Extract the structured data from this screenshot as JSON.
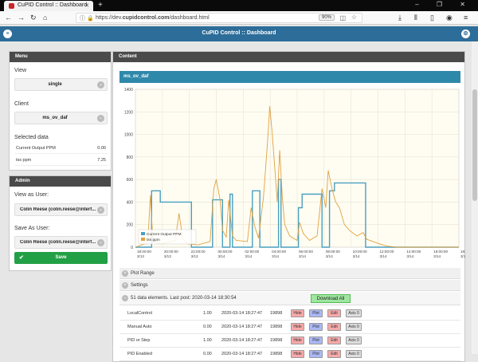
{
  "browser": {
    "tab_title": "CuPID Control :: Dashboard",
    "url_prefix": "https://dev.",
    "url_domain": "cupidcontrol.com",
    "url_path": "/dashboard.html",
    "zoom": "90%"
  },
  "app": {
    "title": "CuPID Control :: Dashboard"
  },
  "menu": {
    "header": "Menu",
    "view_label": "View",
    "view_value": "single",
    "client_label": "Client",
    "client_value": "ms_ov_daf",
    "selected_label": "Selected data",
    "selected": [
      {
        "name": "Current Output PPM",
        "value": "0.00"
      },
      {
        "name": "tss ppm",
        "value": "7.25"
      }
    ]
  },
  "admin": {
    "header": "Admin",
    "view_as_label": "View as User:",
    "view_as_value": "Colin Reese (colin.reese@interf...",
    "save_as_label": "Save As User:",
    "save_as_value": "Colin Reese (colin.reese@interf...",
    "save_label": "Save"
  },
  "content": {
    "header": "Content",
    "chart_title": "ms_ov_daf",
    "plot_range": "Plot Range",
    "settings": "Settings",
    "elements_summary": "51 data elements. Last post: 2020-03-14 18:30:54",
    "download_all": "Download All"
  },
  "buttons": {
    "hide": "Hide",
    "plot": "Plot",
    "edit": "Edit",
    "axis": "Axis 0"
  },
  "rows": [
    {
      "name": "LocalControl",
      "value": "1.00",
      "time": "2020-03-14 18:27:47",
      "count": "19898"
    },
    {
      "name": "Manual Auto",
      "value": "0.00",
      "time": "2020-03-14 18:27:47",
      "count": "19898"
    },
    {
      "name": "PID or Step",
      "value": "1.00",
      "time": "2020-03-14 18:27:47",
      "count": "19898"
    },
    {
      "name": "PID Enabled",
      "value": "0.00",
      "time": "2020-03-14 18:27:47",
      "count": "19898"
    }
  ],
  "chart_data": {
    "type": "line",
    "title": "",
    "ylim": [
      0,
      1400
    ],
    "yticks": [
      "0",
      "200",
      "400",
      "600",
      "800",
      "1000",
      "1200",
      "1400"
    ],
    "xticks": [
      {
        "t": "18:00:00",
        "d": "3/13"
      },
      {
        "t": "20:00:00",
        "d": "3/13"
      },
      {
        "t": "22:00:00",
        "d": "3/13"
      },
      {
        "t": "00:00:00",
        "d": "3/14"
      },
      {
        "t": "02:00:00",
        "d": "3/14"
      },
      {
        "t": "04:00:00",
        "d": "3/14"
      },
      {
        "t": "06:00:00",
        "d": "3/14"
      },
      {
        "t": "08:00:00",
        "d": "3/14"
      },
      {
        "t": "10:00:00",
        "d": "3/14"
      },
      {
        "t": "12:00:00",
        "d": "3/14"
      },
      {
        "t": "14:00:00",
        "d": "3/14"
      },
      {
        "t": "16:00:00",
        "d": "3/14"
      },
      {
        "t": "18:00:00",
        "d": "3/14"
      }
    ],
    "xlim_hours": [
      0,
      26
    ],
    "legend_position": "bottom-left",
    "series": [
      {
        "name": "Current Output PPM",
        "color": "#4a9fc0",
        "points": [
          [
            0,
            0
          ],
          [
            1.3,
            0
          ],
          [
            1.3,
            500
          ],
          [
            2.0,
            500
          ],
          [
            2.0,
            400
          ],
          [
            4.5,
            400
          ],
          [
            4.5,
            0
          ],
          [
            6.2,
            0
          ],
          [
            6.2,
            420
          ],
          [
            7.0,
            420
          ],
          [
            7.0,
            0
          ],
          [
            7.6,
            0
          ],
          [
            7.6,
            470
          ],
          [
            7.8,
            470
          ],
          [
            7.8,
            0
          ],
          [
            9.4,
            0
          ],
          [
            9.4,
            500
          ],
          [
            10.0,
            500
          ],
          [
            10.0,
            0
          ],
          [
            11.5,
            0
          ],
          [
            11.5,
            600
          ],
          [
            11.7,
            600
          ],
          [
            11.7,
            0
          ],
          [
            13.1,
            0
          ],
          [
            13.1,
            350
          ],
          [
            13.4,
            350
          ],
          [
            13.4,
            470
          ],
          [
            15.0,
            470
          ],
          [
            15.0,
            0
          ],
          [
            15.6,
            0
          ],
          [
            15.6,
            500
          ],
          [
            16.0,
            500
          ],
          [
            16.0,
            570
          ],
          [
            18.5,
            570
          ],
          [
            18.5,
            0
          ],
          [
            26,
            0
          ]
        ]
      },
      {
        "name": "tss ppm",
        "color": "#e0a040",
        "points": [
          [
            0,
            0
          ],
          [
            1.0,
            40
          ],
          [
            1.2,
            460
          ],
          [
            1.4,
            60
          ],
          [
            2.0,
            30
          ],
          [
            3.2,
            60
          ],
          [
            3.5,
            300
          ],
          [
            3.8,
            80
          ],
          [
            4.2,
            30
          ],
          [
            5.0,
            20
          ],
          [
            6.0,
            50
          ],
          [
            6.3,
            520
          ],
          [
            6.5,
            600
          ],
          [
            6.8,
            420
          ],
          [
            7.0,
            150
          ],
          [
            7.3,
            90
          ],
          [
            7.5,
            420
          ],
          [
            7.8,
            100
          ],
          [
            8.1,
            60
          ],
          [
            9.0,
            50
          ],
          [
            9.3,
            350
          ],
          [
            9.6,
            180
          ],
          [
            9.9,
            80
          ],
          [
            10.3,
            450
          ],
          [
            10.6,
            900
          ],
          [
            10.8,
            1250
          ],
          [
            11.0,
            1000
          ],
          [
            11.2,
            700
          ],
          [
            11.4,
            400
          ],
          [
            11.6,
            860
          ],
          [
            11.8,
            450
          ],
          [
            12.0,
            200
          ],
          [
            12.4,
            100
          ],
          [
            13.0,
            60
          ],
          [
            13.2,
            220
          ],
          [
            13.5,
            120
          ],
          [
            14.0,
            60
          ],
          [
            14.6,
            100
          ],
          [
            15.0,
            520
          ],
          [
            15.3,
            350
          ],
          [
            15.5,
            680
          ],
          [
            15.8,
            520
          ],
          [
            16.1,
            400
          ],
          [
            16.4,
            350
          ],
          [
            16.8,
            200
          ],
          [
            17.2,
            150
          ],
          [
            17.8,
            100
          ],
          [
            18.3,
            130
          ],
          [
            18.6,
            70
          ],
          [
            19.1,
            50
          ],
          [
            19.6,
            30
          ],
          [
            20.2,
            10
          ],
          [
            21,
            0
          ],
          [
            26,
            0
          ]
        ]
      }
    ]
  }
}
